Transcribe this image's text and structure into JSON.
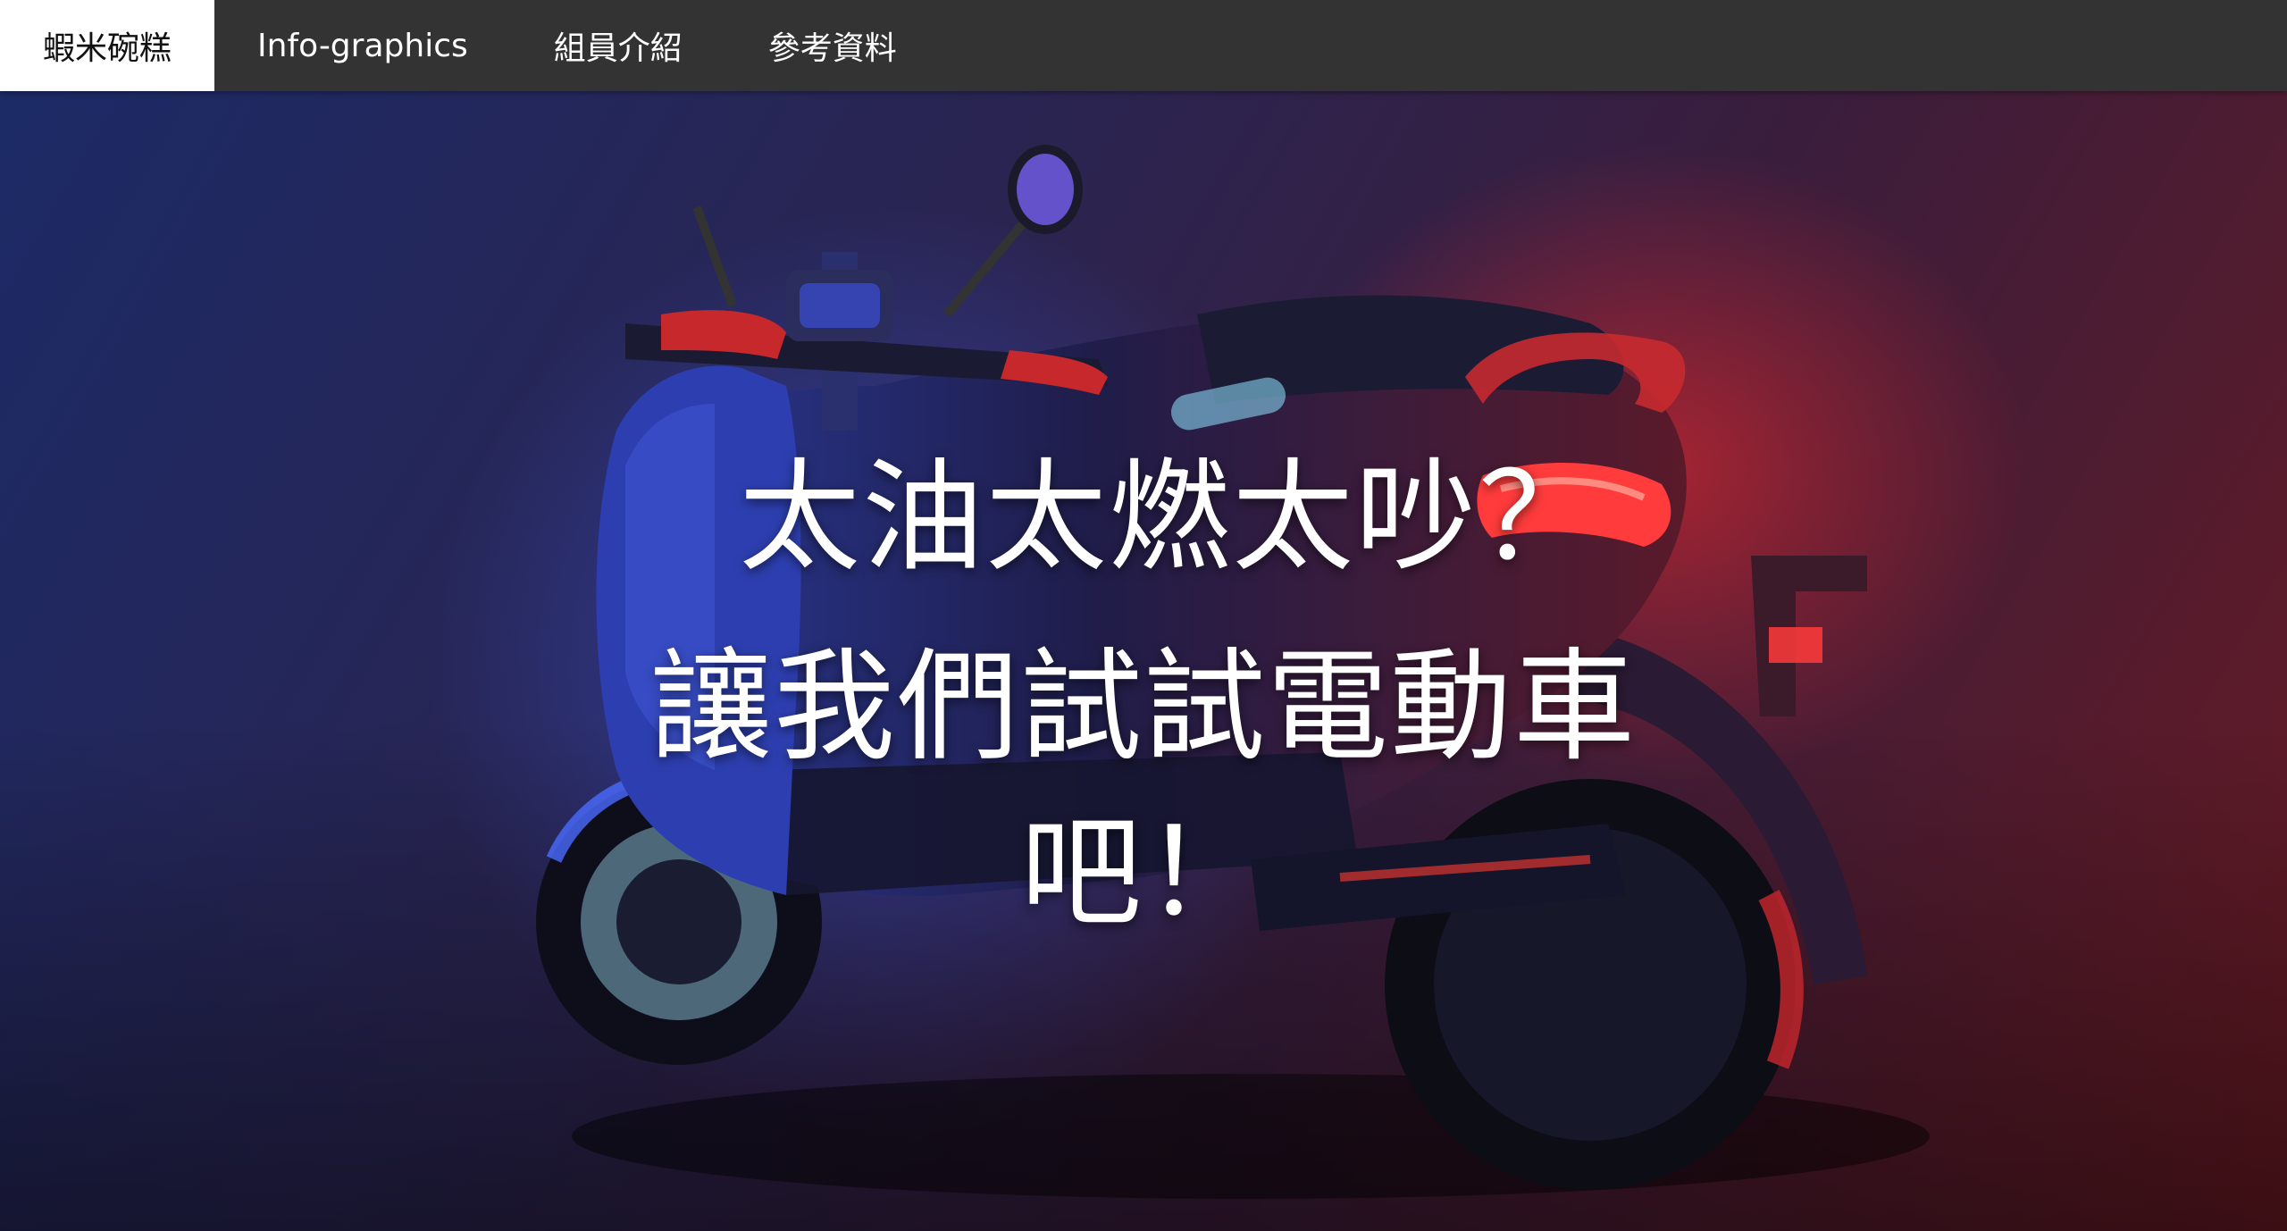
{
  "nav": {
    "items": [
      {
        "label": "蝦米碗糕",
        "active": true
      },
      {
        "label": "Info-graphics",
        "active": false
      },
      {
        "label": "組員介紹",
        "active": false
      },
      {
        "label": "參考資料",
        "active": false
      }
    ]
  },
  "hero": {
    "line1": "太油太燃太吵？",
    "line2": "讓我們試試電動車",
    "line3": "吧！",
    "background_image": "electric-scooter-photo",
    "colors": {
      "gradient_blue": "#1c2a66",
      "gradient_red": "#6a1a22",
      "accent_red": "#ff3b30",
      "accent_blue": "#3a6cff"
    }
  }
}
